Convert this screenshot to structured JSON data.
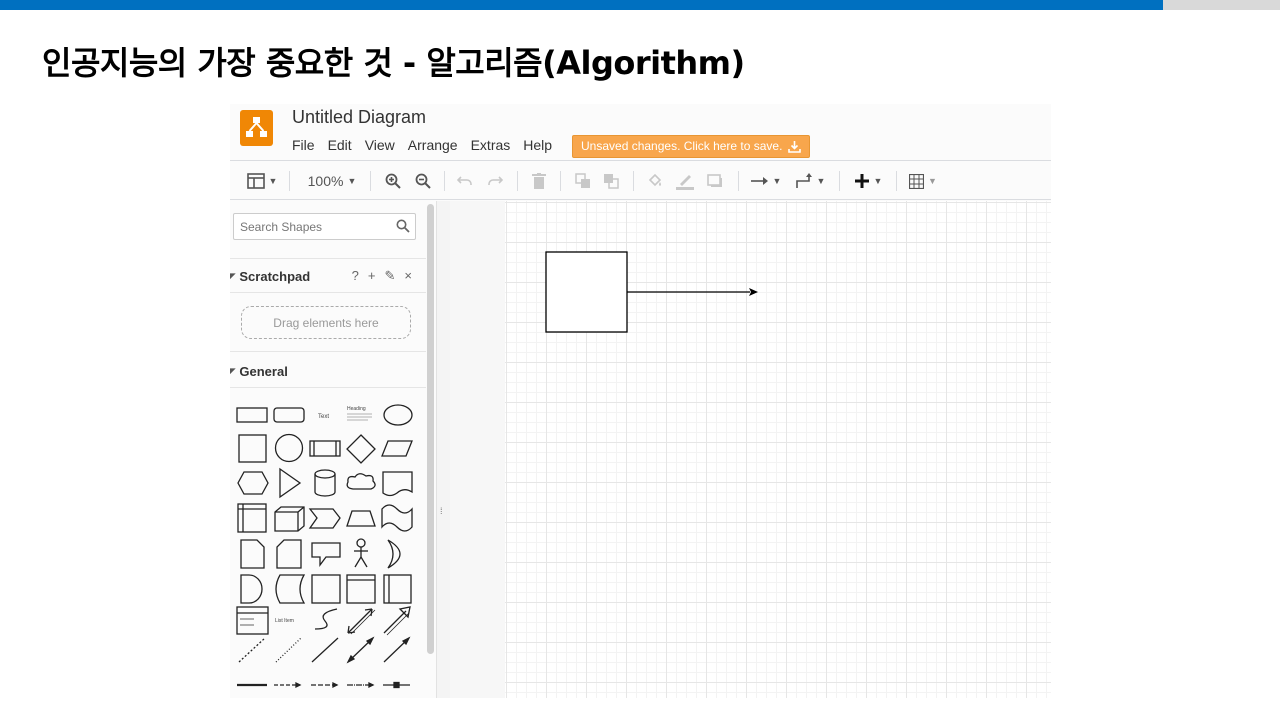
{
  "slide": {
    "title": "인공지능의 가장 중요한 것 - 알고리즘(Algorithm)"
  },
  "app": {
    "document_title": "Untitled Diagram",
    "menu": [
      "File",
      "Edit",
      "View",
      "Arrange",
      "Extras",
      "Help"
    ],
    "save_banner": "Unsaved changes. Click here to save.",
    "accent_color": "#f08705",
    "banner_color": "#f8a64c"
  },
  "toolbar": {
    "zoom": "100%",
    "icons": [
      "format-panel-icon",
      "zoom-in-icon",
      "zoom-out-icon",
      "undo-icon",
      "redo-icon",
      "delete-icon",
      "to-front-icon",
      "to-back-icon",
      "fill-color-icon",
      "line-color-icon",
      "shadow-icon",
      "connection-icon",
      "waypoints-icon",
      "insert-icon",
      "table-icon"
    ]
  },
  "sidebar": {
    "search_placeholder": "Search Shapes",
    "scratchpad": {
      "title": "Scratchpad",
      "tools": [
        "?",
        "+",
        "✎",
        "×"
      ],
      "drop_hint": "Drag elements here"
    },
    "general": {
      "title": "General",
      "text_shape_label": "Text",
      "heading_shape_label": "Heading",
      "list_item_label": "List Item"
    }
  },
  "canvas": {
    "shapes": [
      "rectangle",
      "arrow"
    ]
  }
}
